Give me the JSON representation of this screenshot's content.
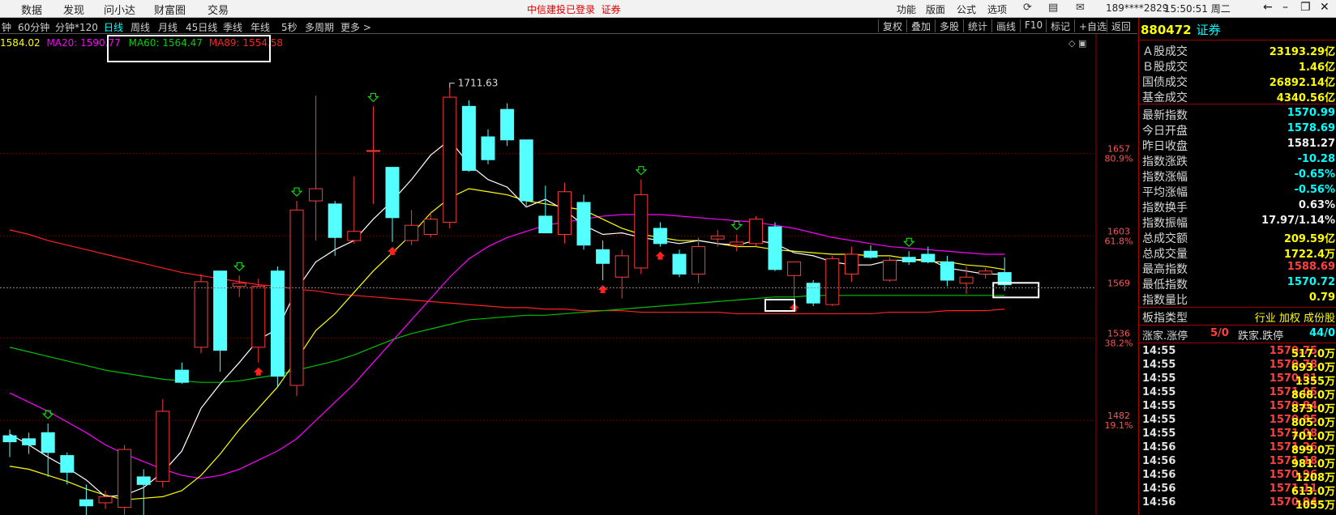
{
  "colors": {
    "up": "#ff3a3a",
    "down": "#54ffff",
    "ma5": "#ffffff",
    "ma10": "#ffff00",
    "ma20": "#ff00ff",
    "ma60": "#00c000",
    "ma89": "#ff2020",
    "bg": "#000000",
    "grid": "#800000"
  },
  "topbar": {
    "menu": [
      "数据",
      "发现",
      "问小达",
      "财富圈",
      "交易"
    ],
    "login_status": "中信建投已登录",
    "login_link": "证券",
    "right_menu": [
      "功能",
      "版面",
      "公式",
      "选项"
    ],
    "user": "189****2829",
    "clock": "15:50:51 周二"
  },
  "toolbar": {
    "periods": [
      "钟",
      "60分钟",
      "分钟*120",
      "日线",
      "周线",
      "月线",
      "45日线",
      "季线",
      "年线",
      "5秒",
      "多周期",
      "更多 >"
    ],
    "active_period": "日线",
    "right_buttons": [
      "复权",
      "叠加",
      "多股",
      "统计",
      "画线",
      "F10",
      "标记",
      "+自选",
      "返回"
    ]
  },
  "ma_legend": [
    {
      "text": "1584.02",
      "color": "#ffff00"
    },
    {
      "text": "MA20: 1590.77",
      "color": "#ff00ff"
    },
    {
      "text": "MA60: 1564.47",
      "color": "#00d000"
    },
    {
      "text": "MA89: 1554.58",
      "color": "#ff2020"
    }
  ],
  "chart_annotations": {
    "peak_label": "1711.63",
    "price_axis": [
      {
        "price": "1657",
        "pct": "80.9%"
      },
      {
        "price": "1603",
        "pct": "61.8%"
      },
      {
        "price": "1569",
        "pct": ""
      },
      {
        "price": "1536",
        "pct": "38.2%"
      },
      {
        "price": "1482",
        "pct": "19.1%"
      }
    ]
  },
  "chart_data": {
    "type": "candlestick",
    "ylim": [
      1420,
      1728
    ],
    "candles": [
      {
        "o": 1472,
        "h": 1476,
        "l": 1458,
        "c": 1468
      },
      {
        "o": 1470,
        "h": 1474,
        "l": 1460,
        "c": 1466
      },
      {
        "o": 1474,
        "h": 1480,
        "l": 1445,
        "c": 1461
      },
      {
        "o": 1459,
        "h": 1461,
        "l": 1440,
        "c": 1448
      },
      {
        "o": 1430,
        "h": 1440,
        "l": 1418,
        "c": 1426
      },
      {
        "o": 1428,
        "h": 1436,
        "l": 1424,
        "c": 1432
      },
      {
        "o": 1425,
        "h": 1466,
        "l": 1420,
        "c": 1463
      },
      {
        "o": 1445,
        "h": 1450,
        "l": 1418,
        "c": 1440
      },
      {
        "o": 1442,
        "h": 1496,
        "l": 1438,
        "c": 1488
      },
      {
        "o": 1515,
        "h": 1520,
        "l": 1506,
        "c": 1507
      },
      {
        "o": 1530,
        "h": 1578,
        "l": 1526,
        "c": 1573
      },
      {
        "o": 1580,
        "h": 1578,
        "l": 1514,
        "c": 1528
      },
      {
        "o": 1570,
        "h": 1577,
        "l": 1563,
        "c": 1572
      },
      {
        "o": 1530,
        "h": 1575,
        "l": 1520,
        "c": 1570
      },
      {
        "o": 1580,
        "h": 1583,
        "l": 1504,
        "c": 1511
      },
      {
        "o": 1505,
        "h": 1626,
        "l": 1498,
        "c": 1620
      },
      {
        "o": 1626,
        "h": 1695,
        "l": 1600,
        "c": 1634
      },
      {
        "o": 1624,
        "h": 1626,
        "l": 1590,
        "c": 1602
      },
      {
        "o": 1600,
        "h": 1642,
        "l": 1598,
        "c": 1606
      },
      {
        "o": 1659,
        "h": 1688,
        "l": 1624,
        "c": 1659
      },
      {
        "o": 1648,
        "h": 1645,
        "l": 1599,
        "c": 1615
      },
      {
        "o": 1600,
        "h": 1620,
        "l": 1597,
        "c": 1610
      },
      {
        "o": 1604,
        "h": 1619,
        "l": 1602,
        "c": 1614
      },
      {
        "o": 1612,
        "h": 1700,
        "l": 1608,
        "c": 1694
      },
      {
        "o": 1688,
        "h": 1692,
        "l": 1645,
        "c": 1646
      },
      {
        "o": 1668,
        "h": 1673,
        "l": 1650,
        "c": 1653
      },
      {
        "o": 1686,
        "h": 1690,
        "l": 1662,
        "c": 1666
      },
      {
        "o": 1666,
        "h": 1663,
        "l": 1623,
        "c": 1626
      },
      {
        "o": 1616,
        "h": 1636,
        "l": 1608,
        "c": 1605
      },
      {
        "o": 1604,
        "h": 1638,
        "l": 1598,
        "c": 1632
      },
      {
        "o": 1625,
        "h": 1630,
        "l": 1594,
        "c": 1597
      },
      {
        "o": 1594,
        "h": 1600,
        "l": 1574,
        "c": 1585
      },
      {
        "o": 1576,
        "h": 1594,
        "l": 1562,
        "c": 1590
      },
      {
        "o": 1582,
        "h": 1640,
        "l": 1578,
        "c": 1630
      },
      {
        "o": 1608,
        "h": 1612,
        "l": 1596,
        "c": 1598
      },
      {
        "o": 1591,
        "h": 1594,
        "l": 1576,
        "c": 1578
      },
      {
        "o": 1578,
        "h": 1602,
        "l": 1572,
        "c": 1596
      },
      {
        "o": 1601,
        "h": 1607,
        "l": 1596,
        "c": 1603
      },
      {
        "o": 1597,
        "h": 1604,
        "l": 1593,
        "c": 1599
      },
      {
        "o": 1598,
        "h": 1616,
        "l": 1596,
        "c": 1614
      },
      {
        "o": 1609,
        "h": 1612,
        "l": 1580,
        "c": 1581
      },
      {
        "o": 1577,
        "h": 1586,
        "l": 1562,
        "c": 1586
      },
      {
        "o": 1572,
        "h": 1574,
        "l": 1557,
        "c": 1559
      },
      {
        "o": 1558,
        "h": 1590,
        "l": 1557,
        "c": 1588
      },
      {
        "o": 1578,
        "h": 1596,
        "l": 1573,
        "c": 1591
      },
      {
        "o": 1593,
        "h": 1597,
        "l": 1588,
        "c": 1589
      },
      {
        "o": 1574,
        "h": 1589,
        "l": 1573,
        "c": 1587
      },
      {
        "o": 1589,
        "h": 1593,
        "l": 1584,
        "c": 1586
      },
      {
        "o": 1591,
        "h": 1596,
        "l": 1585,
        "c": 1586
      },
      {
        "o": 1586,
        "h": 1590,
        "l": 1570,
        "c": 1574
      },
      {
        "o": 1572,
        "h": 1583,
        "l": 1565,
        "c": 1576
      },
      {
        "o": 1578,
        "h": 1582,
        "l": 1575,
        "c": 1580
      },
      {
        "o": 1579,
        "h": 1589,
        "l": 1567,
        "c": 1571
      }
    ],
    "ma5": [
      1473,
      1466,
      1458,
      1451,
      1443,
      1432,
      1433,
      1438,
      1448,
      1462,
      1490,
      1506,
      1520,
      1535,
      1542,
      1568,
      1586,
      1594,
      1600,
      1614,
      1626,
      1640,
      1656,
      1666,
      1650,
      1640,
      1635,
      1622,
      1627,
      1620,
      1610,
      1604,
      1605,
      1602,
      1600,
      1598,
      1600,
      1598,
      1597,
      1600,
      1598,
      1592,
      1590,
      1586,
      1584,
      1584,
      1587,
      1587,
      1588,
      1582,
      1580,
      1578,
      1578
    ],
    "ma10": [
      1452,
      1450,
      1446,
      1442,
      1437,
      1433,
      1430,
      1431,
      1432,
      1436,
      1446,
      1460,
      1476,
      1490,
      1504,
      1522,
      1541,
      1552,
      1566,
      1580,
      1592,
      1604,
      1618,
      1628,
      1634,
      1632,
      1630,
      1626,
      1624,
      1622,
      1620,
      1614,
      1608,
      1604,
      1602,
      1600,
      1600,
      1598,
      1596,
      1596,
      1594,
      1593,
      1592,
      1591,
      1591,
      1590,
      1590,
      1588,
      1586,
      1586,
      1584,
      1583,
      1581
    ],
    "ma20": [
      1500,
      1494,
      1488,
      1481,
      1474,
      1466,
      1460,
      1455,
      1450,
      1446,
      1444,
      1446,
      1450,
      1456,
      1462,
      1470,
      1482,
      1494,
      1506,
      1520,
      1534,
      1548,
      1562,
      1576,
      1588,
      1596,
      1602,
      1606,
      1610,
      1612,
      1614,
      1616,
      1617,
      1617,
      1617,
      1616,
      1615,
      1614,
      1613,
      1612,
      1610,
      1608,
      1605,
      1602,
      1600,
      1598,
      1596,
      1595,
      1594,
      1593,
      1592,
      1591,
      1591
    ],
    "ma60": [
      1530,
      1527,
      1524,
      1521,
      1518,
      1515,
      1513,
      1511,
      1509,
      1508,
      1507,
      1507,
      1508,
      1510,
      1512,
      1515,
      1518,
      1521,
      1525,
      1530,
      1535,
      1539,
      1542,
      1545,
      1548,
      1549,
      1550,
      1551,
      1551,
      1552,
      1553,
      1554,
      1555,
      1556,
      1557,
      1558,
      1559,
      1560,
      1561,
      1562,
      1563,
      1563,
      1564,
      1564,
      1564,
      1564,
      1564,
      1564,
      1564,
      1564,
      1564,
      1564,
      1564
    ],
    "ma89": [
      1607,
      1604,
      1600,
      1597,
      1594,
      1591,
      1588,
      1585,
      1582,
      1579,
      1577,
      1575,
      1573,
      1571,
      1570,
      1568,
      1567,
      1565,
      1564,
      1563,
      1562,
      1561,
      1560,
      1559,
      1558,
      1557,
      1556,
      1556,
      1555,
      1555,
      1554,
      1554,
      1554,
      1553,
      1553,
      1553,
      1553,
      1553,
      1552,
      1552,
      1552,
      1552,
      1552,
      1552,
      1552,
      1552,
      1553,
      1553,
      1553,
      1554,
      1554,
      1554,
      1555
    ]
  },
  "right_panel": {
    "code": "880472",
    "name": "证券",
    "market_stats": [
      {
        "label": "Ａ股成交",
        "value": "23193.29亿",
        "color": "#ffff00"
      },
      {
        "label": "Ｂ股成交",
        "value": "1.46亿",
        "color": "#ffff00"
      },
      {
        "label": "国债成交",
        "value": "26892.14亿",
        "color": "#ffff00"
      },
      {
        "label": "基金成交",
        "value": "4340.56亿",
        "color": "#ffff00"
      }
    ],
    "index_stats": [
      {
        "label": "最新指数",
        "value": "1570.99",
        "color": "#00ffff"
      },
      {
        "label": "今日开盘",
        "value": "1578.69",
        "color": "#00ffff"
      },
      {
        "label": "昨日收盘",
        "value": "1581.27",
        "color": "#f0f0f0"
      },
      {
        "label": "指数涨跌",
        "value": "-10.28",
        "color": "#00ffff"
      },
      {
        "label": "指数涨幅",
        "value": "-0.65%",
        "color": "#00ffff"
      },
      {
        "label": "平均涨幅",
        "value": "-0.56%",
        "color": "#00ffff"
      },
      {
        "label": "指数换手",
        "value": "0.63%",
        "color": "#f0f0f0"
      },
      {
        "label": "指数振幅",
        "value": "17.97/1.14%",
        "color": "#f0f0f0"
      },
      {
        "label": "总成交额",
        "value": "209.59亿",
        "color": "#ffff00"
      },
      {
        "label": "总成交量",
        "value": "1722.4万",
        "color": "#ffff00"
      },
      {
        "label": "最高指数",
        "value": "1588.69",
        "color": "#ff4040"
      },
      {
        "label": "最低指数",
        "value": "1570.72",
        "color": "#00ffff"
      },
      {
        "label": "指数量比",
        "value": "0.79",
        "color": "#ffff00"
      }
    ],
    "board_type_label": "板指类型",
    "board_type_value": "行业 加权 成份股",
    "limit_up_label": "涨家.涨停",
    "limit_up_value": "5/0",
    "limit_down_label": "跌家.跌停",
    "limit_down_value": "44/0",
    "ticks": [
      {
        "time": "14:55",
        "price": "1570.75",
        "vol": "517.0万"
      },
      {
        "time": "14:55",
        "price": "1570.78",
        "vol": "693.0万"
      },
      {
        "time": "14:55",
        "price": "1570.81",
        "vol": "1355万"
      },
      {
        "time": "14:55",
        "price": "1571.05",
        "vol": "868.0万"
      },
      {
        "time": "14:55",
        "price": "1570.84",
        "vol": "873.0万"
      },
      {
        "time": "14:55",
        "price": "1570.85",
        "vol": "805.0万"
      },
      {
        "time": "14:55",
        "price": "1571.08",
        "vol": "701.0万"
      },
      {
        "time": "14:56",
        "price": "1571.26",
        "vol": "899.0万"
      },
      {
        "time": "14:56",
        "price": "1571.18",
        "vol": "981.0万"
      },
      {
        "time": "14:56",
        "price": "1570.96",
        "vol": "1208万"
      },
      {
        "time": "14:56",
        "price": "1571.11",
        "vol": "613.0万"
      },
      {
        "time": "14:56",
        "price": "1570.94",
        "vol": "1055万"
      }
    ]
  }
}
